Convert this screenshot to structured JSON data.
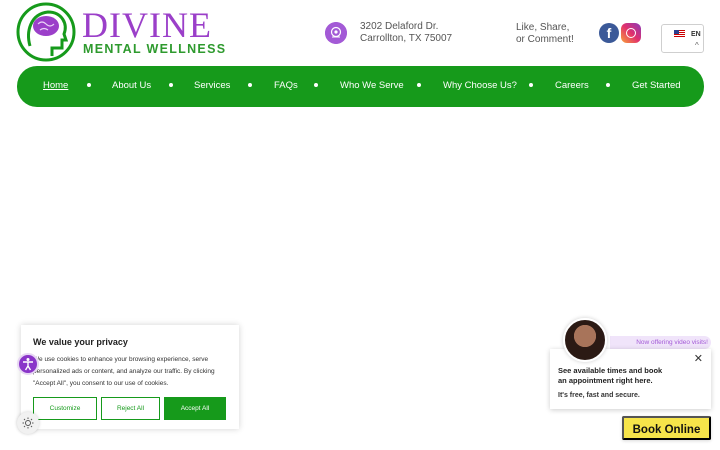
{
  "brand": {
    "title": "DIVINE",
    "subtitle": "MENTAL WELLNESS",
    "colors": {
      "purple": "#9b3fc9",
      "green": "#169a1b"
    }
  },
  "contact": {
    "address_line1": "3202 Delaford Dr.",
    "address_line2": "Carrollton, TX 75007",
    "social_line1": "Like, Share,",
    "social_line2": "or Comment!",
    "facebook_glyph": "f",
    "icons": [
      "location-pin-icon",
      "facebook-icon",
      "instagram-icon"
    ]
  },
  "language": {
    "code": "EN",
    "caret": "^"
  },
  "nav": {
    "items": [
      {
        "label": "Home",
        "active": true
      },
      {
        "label": "About Us"
      },
      {
        "label": "Services"
      },
      {
        "label": "FAQs"
      },
      {
        "label": "Who We Serve"
      },
      {
        "label": "Why Choose Us?"
      },
      {
        "label": "Careers"
      },
      {
        "label": "Get Started"
      }
    ]
  },
  "cookie": {
    "title": "We value your privacy",
    "text": "We use cookies to enhance your browsing experience, serve personalized ads or content, and analyze our traffic. By clicking \"Accept All\", you consent to our use of cookies.",
    "customize": "Customize",
    "reject": "Reject All",
    "accept": "Accept All"
  },
  "booking": {
    "pill": "Now offering video visits!",
    "line1": "See available times and book",
    "line2": "an appointment right here.",
    "sub": "It's free, fast and secure.",
    "close": "✕",
    "cta": "Book Online"
  }
}
